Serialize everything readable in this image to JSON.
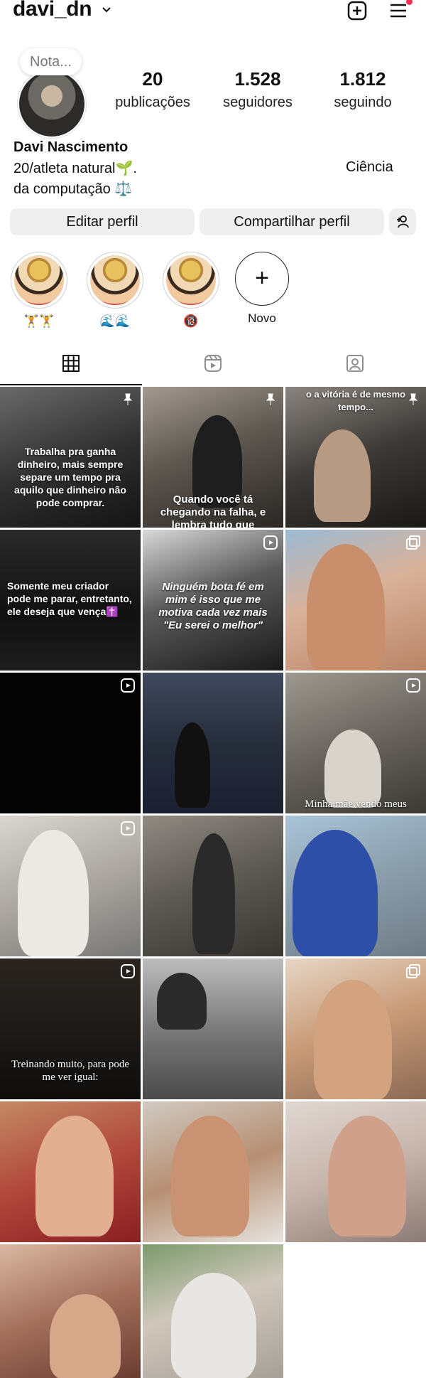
{
  "header": {
    "username": "davi_dn",
    "icons": [
      "chevron-down-icon",
      "new-post-icon",
      "menu-icon"
    ],
    "notification_color": "#ff2d55"
  },
  "profile": {
    "note_placeholder": "Nota...",
    "full_name": "Davi Nascimento",
    "bio_line1": "20/atleta natural🌱.",
    "bio_line2": "da computação ⚖️",
    "bio_right": "Ciência",
    "stats": {
      "posts": {
        "value": "20",
        "label": "publicações"
      },
      "followers": {
        "value": "1.528",
        "label": "seguidores"
      },
      "following": {
        "value": "1.812",
        "label": "seguindo"
      }
    }
  },
  "actions": {
    "edit": "Editar perfil",
    "share": "Compartilhar perfil",
    "add_icon": "add-person-icon"
  },
  "highlights": [
    {
      "label": "🏋️🏋️"
    },
    {
      "label": "🌊🌊"
    },
    {
      "label": "🔞"
    },
    {
      "label": "Novo"
    }
  ],
  "tabs": [
    "grid-icon",
    "reels-icon",
    "tagged-icon"
  ],
  "grid": {
    "captions": {
      "t1": "Trabalha pra ganha dinheiro, mais sempre separe um tempo pra aquilo que dinheiro não pode comprar.",
      "t2": "Quando você tá chegando na falha, e lembra tudo que",
      "t3": "o a vitória é de mesmo tempo...",
      "t4": "Somente meu criador pode me parar, entretanto, ele deseja que vença✝️",
      "t5": "Ninguém bota fé em mim é isso que me motiva cada vez mais \"Eu serei o melhor\"",
      "t9": "Minha mãe vendo meus",
      "t13": "Treinando muito, para pode me ver igual:"
    }
  }
}
